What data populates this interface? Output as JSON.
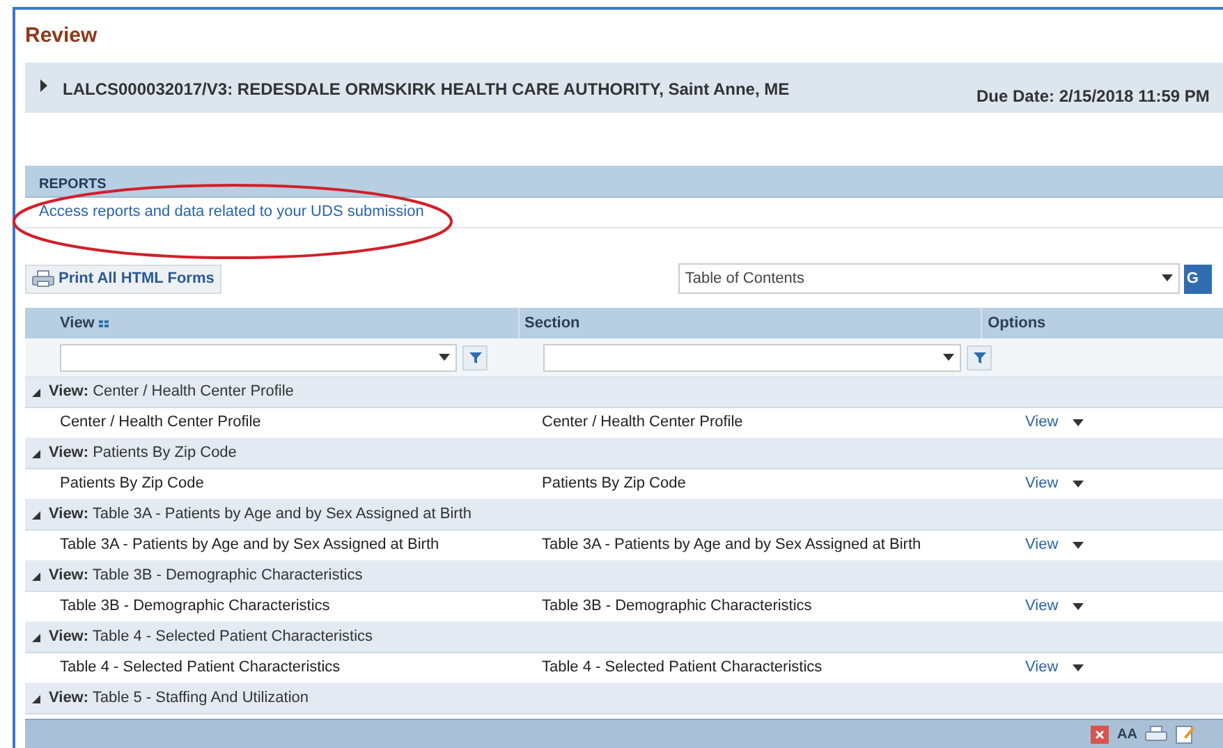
{
  "page_title": "Review",
  "record": {
    "title": "LALCS000032017/V3: REDESDALE ORMSKIRK HEALTH CARE AUTHORITY, Saint Anne, ME",
    "due_date": "Due Date: 2/15/2018 11:59 PM",
    "expanded": false
  },
  "reports": {
    "heading": "REPORTS",
    "link": "Access reports and data related to your UDS submission"
  },
  "toolbar": {
    "print_button": "Print All HTML Forms",
    "dropdown_value": "Table of Contents",
    "go_button": "G"
  },
  "table": {
    "columns": [
      "View",
      "Section",
      "Options"
    ],
    "groups": [
      {
        "prefix": "View:",
        "label": "Center / Health Center Profile",
        "expanded": true,
        "rows": [
          {
            "view": "Center / Health Center Profile",
            "section": "Center / Health Center Profile",
            "option": "View"
          }
        ]
      },
      {
        "prefix": "View:",
        "label": "Patients By Zip Code",
        "expanded": true,
        "rows": [
          {
            "view": "Patients By Zip Code",
            "section": "Patients By Zip Code",
            "option": "View"
          }
        ]
      },
      {
        "prefix": "View:",
        "label": "Table 3A - Patients by Age and by Sex Assigned at Birth",
        "expanded": true,
        "rows": [
          {
            "view": "Table 3A - Patients by Age and by Sex Assigned at Birth",
            "section": "Table 3A - Patients by Age and by Sex Assigned at Birth",
            "option": "View"
          }
        ]
      },
      {
        "prefix": "View:",
        "label": "Table 3B - Demographic Characteristics",
        "expanded": true,
        "rows": [
          {
            "view": "Table 3B - Demographic Characteristics",
            "section": "Table 3B - Demographic Characteristics",
            "option": "View"
          }
        ]
      },
      {
        "prefix": "View:",
        "label": "Table 4 - Selected Patient Characteristics",
        "expanded": true,
        "rows": [
          {
            "view": "Table 4 - Selected Patient Characteristics",
            "section": "Table 4 - Selected Patient Characteristics",
            "option": "View"
          }
        ]
      },
      {
        "prefix": "View:",
        "label": "Table 5 - Staffing And Utilization",
        "expanded": true
      }
    ]
  },
  "footer_bar": {
    "font_size_button": "AA"
  }
}
